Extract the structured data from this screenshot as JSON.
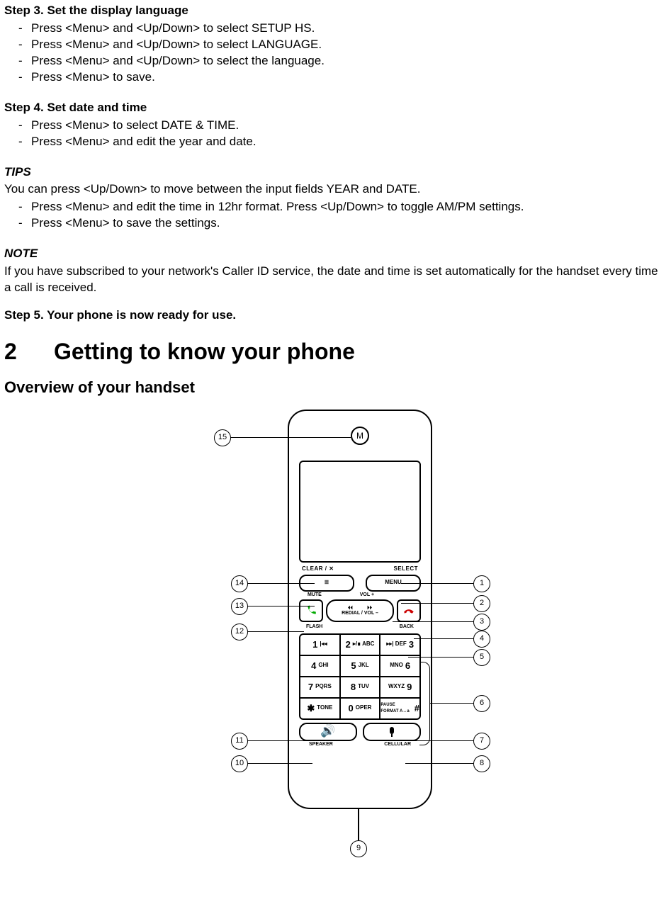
{
  "step3": {
    "title": "Step 3. Set the display language",
    "items": [
      "Press <Menu> and <Up/Down> to select SETUP HS.",
      "Press <Menu> and <Up/Down> to select LANGUAGE.",
      "Press <Menu> and <Up/Down> to select the language.",
      "Press <Menu> to save."
    ]
  },
  "step4": {
    "title": "Step 4. Set date and time",
    "items": [
      "Press <Menu> to select DATE & TIME.",
      "Press <Menu> and edit the year and date."
    ]
  },
  "tips": {
    "title": "TIPS",
    "intro": "You can press <Up/Down> to move between the input fields YEAR and DATE.",
    "items": [
      "Press <Menu> and edit the time in 12hr format. Press <Up/Down> to toggle AM/PM settings.",
      "Press <Menu> to save the settings."
    ]
  },
  "note": {
    "title": "NOTE",
    "text": "If you have subscribed to your network's Caller ID service, the date and time is set automatically for the handset every time a call is received."
  },
  "step5": "Step 5. Your phone is now ready for use.",
  "section": {
    "num": "2",
    "title": "Getting to know your phone"
  },
  "overview": "Overview of your handset",
  "diagram": {
    "soft_left_top": "CLEAR / ✕",
    "soft_right_top": "SELECT",
    "soft_left_icon": "≣",
    "soft_right_icon": "MENU",
    "soft_left_under": "MUTE",
    "nav_top": "VOL +",
    "nav_mid_left": "⏴⏴",
    "nav_mid_right": "⏵⏵",
    "nav_center": "REDIAL / VOL –",
    "under_left": "FLASH",
    "under_right": "BACK",
    "keypad": [
      [
        {
          "big": "1",
          "small": "|◂◂"
        },
        {
          "big": "2",
          "small": "▸/∎  ABC"
        },
        {
          "big": "3",
          "small": "▸▸|  DEF"
        }
      ],
      [
        {
          "big": "4",
          "small": "GHI"
        },
        {
          "big": "5",
          "small": "JKL"
        },
        {
          "big": "6",
          "small": "MNO"
        }
      ],
      [
        {
          "big": "7",
          "small": "PQRS"
        },
        {
          "big": "8",
          "small": "TUV"
        },
        {
          "big": "9",
          "small": "WXYZ"
        }
      ],
      [
        {
          "big": "✱",
          "small": "TONE"
        },
        {
          "big": "0",
          "small": "OPER"
        },
        {
          "big": "#",
          "small": "PAUSE FORMAT A↔a"
        }
      ]
    ],
    "bottom_left": "SPEAKER",
    "bottom_right": "CELLULAR",
    "callouts_right": [
      "1",
      "2",
      "3",
      "4",
      "5",
      "6",
      "7",
      "8"
    ],
    "callouts_left": [
      "15",
      "14",
      "13",
      "12",
      "11",
      "10"
    ],
    "callout_bottom": "9"
  }
}
